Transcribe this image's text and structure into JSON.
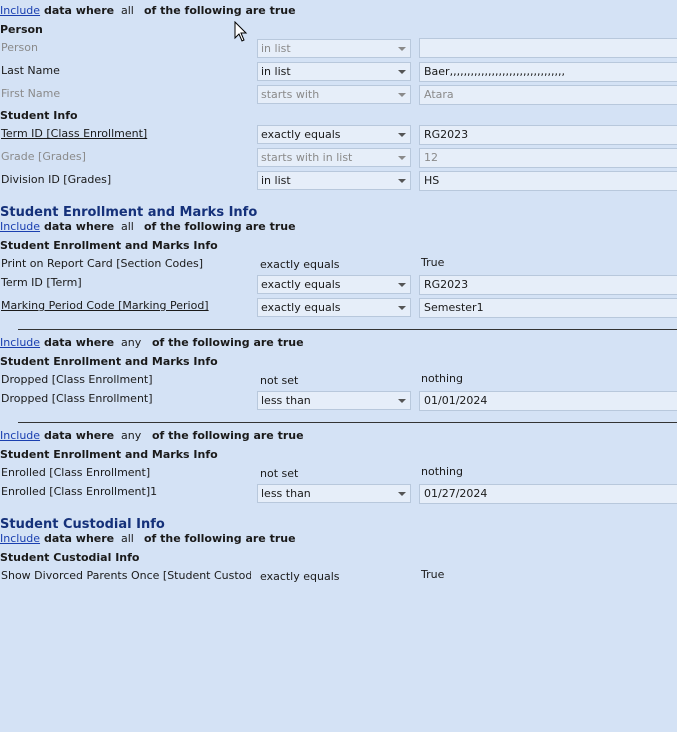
{
  "top_group": {
    "include": "Include",
    "data_where": "data where",
    "quantifier": "all",
    "tail": "of the following are true",
    "person_label": "Person",
    "rows": [
      {
        "label": "Person",
        "operator": "in list",
        "value": ""
      },
      {
        "label": "Last Name",
        "operator": "in list",
        "value": "Baer,,,,,,,,,,,,,,,,,,,,,,,,,,,,,,,,,"
      },
      {
        "label": "First Name",
        "operator": "starts with",
        "value": "Atara"
      }
    ],
    "student_info_label": "Student Info",
    "student_rows": [
      {
        "label": "Term ID [Class Enrollment]",
        "operator": "exactly equals",
        "value": "RG2023"
      },
      {
        "label": "Grade  [Grades]",
        "operator": "starts with in list",
        "value": "12"
      },
      {
        "label": "Division ID [Grades]",
        "operator": "in list",
        "value": "HS"
      }
    ]
  },
  "enrollment": {
    "title": "Student Enrollment and Marks Info",
    "include": "Include",
    "data_where": "data where",
    "quantifier": "all",
    "tail": "of the following are true",
    "group_label": "Student Enrollment and Marks Info",
    "rows": [
      {
        "label": "Print on Report Card [Section Codes]",
        "operator": "exactly equals",
        "value": "True"
      },
      {
        "label": "Term ID [Term]",
        "operator": "exactly equals",
        "value": "RG2023"
      },
      {
        "label": "Marking Period Code [Marking Period]",
        "operator": "exactly equals",
        "value": "Semester1"
      }
    ]
  },
  "dropped_group": {
    "include": "Include",
    "data_where": "data where",
    "quantifier": "any",
    "tail": "of the following are true",
    "group_label": "Student Enrollment and Marks Info",
    "rows": [
      {
        "label": "Dropped [Class Enrollment]",
        "operator": "not set",
        "value": "nothing"
      },
      {
        "label": "Dropped [Class Enrollment]",
        "operator": "less than",
        "value": "01/01/2024"
      }
    ]
  },
  "enrolled_group": {
    "include": "Include",
    "data_where": "data where",
    "quantifier": "any",
    "tail": "of the following are true",
    "group_label": "Student Enrollment and Marks Info",
    "rows": [
      {
        "label": "Enrolled [Class Enrollment]",
        "operator": "not set",
        "value": "nothing"
      },
      {
        "label": "Enrolled [Class Enrollment]1",
        "operator": "less than",
        "value": "01/27/2024"
      }
    ]
  },
  "custodial": {
    "title": "Student Custodial Info",
    "include": "Include",
    "data_where": "data where",
    "quantifier": "all",
    "tail": "of the following are true",
    "group_label": "Student Custodial Info",
    "rows": [
      {
        "label": "Show Divorced Parents Once [Student Custodial I",
        "operator": "exactly equals",
        "value": "True"
      }
    ]
  }
}
